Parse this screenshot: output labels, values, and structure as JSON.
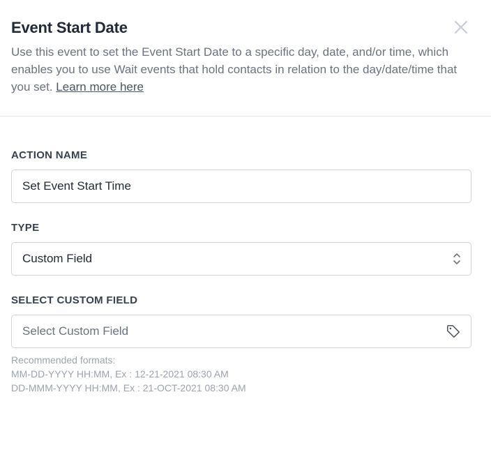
{
  "header": {
    "title": "Event Start Date",
    "description": "Use this event to set the Event Start Date to a specific day, date, and/or time, which enables you to use Wait events that hold contacts in relation to the day/date/time that you set.",
    "learn_more": "Learn more here",
    "close_icon": "close-icon"
  },
  "action_name": {
    "label": "ACTION NAME",
    "value": "Set Event Start Time"
  },
  "type": {
    "label": "TYPE",
    "selected": "Custom Field",
    "icon": "chevron-up-down-icon"
  },
  "custom_field": {
    "label": "SELECT CUSTOM FIELD",
    "placeholder": "Select Custom Field",
    "icon": "tag-icon"
  },
  "hints": {
    "line1": "Recommended formats:",
    "line2": "MM-DD-YYYY HH:MM, Ex : 12-21-2021 08:30 AM",
    "line3": "DD-MMM-YYYY HH:MM, Ex : 21-OCT-2021 08:30 AM"
  },
  "colors": {
    "title": "#1f2937",
    "muted": "#6b7280",
    "border": "#d1d5db",
    "divider": "#e5e7eb",
    "close": "#c7cdd6"
  }
}
